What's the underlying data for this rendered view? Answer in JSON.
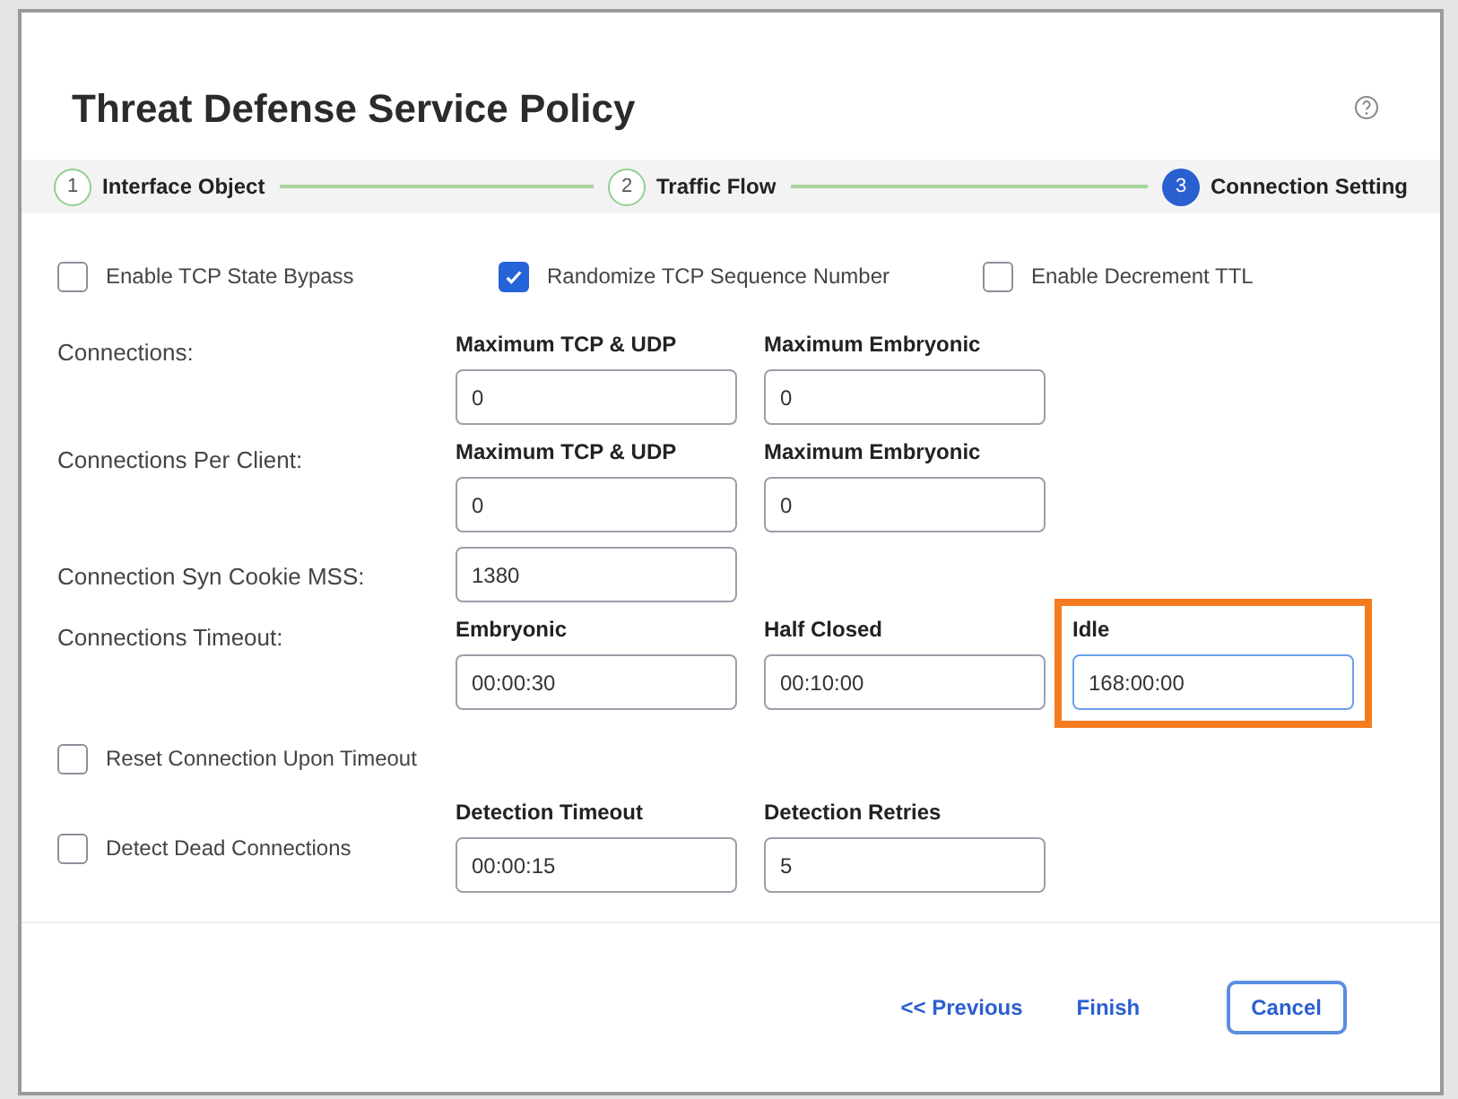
{
  "dialog": {
    "title": "Threat Defense Service Policy"
  },
  "steps": [
    {
      "number": "1",
      "label": "Interface Object",
      "selected": false
    },
    {
      "number": "2",
      "label": "Traffic Flow",
      "selected": false
    },
    {
      "number": "3",
      "label": "Connection Setting",
      "selected": true
    }
  ],
  "options": [
    {
      "label": "Enable TCP State Bypass",
      "checked": false
    },
    {
      "label": "Randomize TCP Sequence Number",
      "checked": true
    },
    {
      "label": "Enable Decrement TTL",
      "checked": false
    }
  ],
  "rows": [
    {
      "kind": "fields",
      "label": "Connections:",
      "fields": [
        {
          "label": "Maximum TCP & UDP",
          "value": "0",
          "highlighted": false
        },
        {
          "label": "Maximum Embryonic",
          "value": "0",
          "highlighted": false
        }
      ]
    },
    {
      "kind": "fields",
      "label": "Connections Per Client:",
      "fields": [
        {
          "label": "Maximum TCP & UDP",
          "value": "0",
          "highlighted": false
        },
        {
          "label": "Maximum Embryonic",
          "value": "0",
          "highlighted": false
        }
      ]
    },
    {
      "kind": "fields",
      "label": "Connection Syn Cookie MSS:",
      "fields": [
        {
          "value": "1380",
          "highlighted": false
        }
      ]
    },
    {
      "kind": "fields",
      "label": "Connections Timeout:",
      "fields": [
        {
          "label": "Embryonic",
          "value": "00:00:30",
          "highlighted": false
        },
        {
          "label": "Half Closed",
          "value": "00:10:00",
          "highlighted": false
        },
        {
          "label": "Idle",
          "value": "168:00:00",
          "highlighted": true
        }
      ]
    },
    {
      "kind": "checkbox",
      "label": "Reset Connection Upon Timeout",
      "checked": false
    },
    {
      "kind": "checkbox-fields",
      "label": "Detect Dead Connections",
      "checked": false,
      "fields": [
        {
          "label": "Detection Timeout",
          "value": "00:00:15",
          "highlighted": false
        },
        {
          "label": "Detection Retries",
          "value": "5",
          "highlighted": false
        }
      ]
    }
  ],
  "buttons": [
    {
      "kind": "link",
      "label": "<< Previous"
    },
    {
      "kind": "link",
      "label": "Finish"
    },
    {
      "kind": "outline",
      "label": "Cancel"
    }
  ]
}
